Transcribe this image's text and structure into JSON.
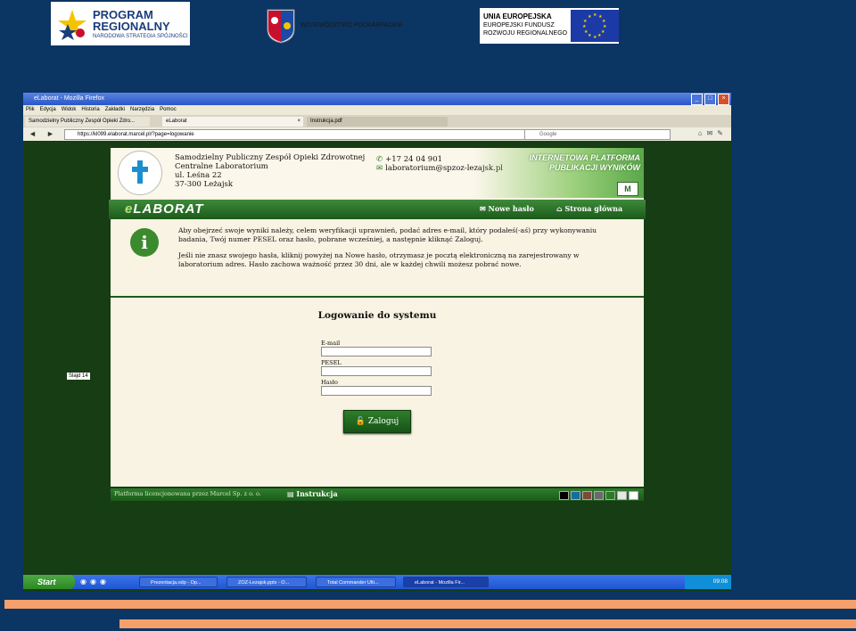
{
  "top_logos": {
    "program_line1": "PROGRAM",
    "program_line2": "REGIONALNY",
    "program_line3": "NARODOWA STRATEGIA SPÓJNOŚCI",
    "woj_text": "WOJEWÓDZTWO PODKARPACKIE",
    "ue_line1": "UNIA EUROPEJSKA",
    "ue_line2": "EUROPEJSKI FUNDUSZ",
    "ue_line3": "ROZWOJU REGIONALNEGO"
  },
  "browser": {
    "title": "eLaborat - Mozilla Firefox",
    "menu": [
      "Plik",
      "Edycja",
      "Widok",
      "Historia",
      "Zakładki",
      "Narzędzia",
      "Pomoc"
    ],
    "tabs": [
      {
        "label": "Samodzielny Publiczny Zespół Opieki Zdro..."
      },
      {
        "label": "eLaborat"
      },
      {
        "label": "Instrukcja.pdf"
      }
    ],
    "url": "https://kl099.elaborat.marcel.pl/?page=logowanie",
    "search_placeholder": "Google"
  },
  "site": {
    "org_name_1": "Samodzielny Publiczny Zespół Opieki Zdrowotnej",
    "org_name_2": "Centralne Laboratorium",
    "org_street": "ul. Leśna 22",
    "org_city": "37-300 Leżajsk",
    "phone": "+17 24 04 901",
    "email": "laboratorium@spzoz-lezajsk.pl",
    "banner_1": "INTERNETOWA PLATFORMA",
    "banner_2": "PUBLIKACJI WYNIKÓW",
    "banner_logo": "M",
    "brand_e": "e",
    "brand_rest": "LABORAT",
    "nav_new_password": "Nowe hasło",
    "nav_home": "Strona główna",
    "info_p1": "Aby obejrzeć swoje wyniki należy, celem weryfikacji uprawnień, podać adres e-mail, który podałeś(-aś) przy wykonywaniu badania, Twój numer PESEL oraz hasło, pobrane wcześniej, a następnie kliknąć Zaloguj.",
    "info_p2": "Jeśli nie znasz swojego hasła, kliknij powyżej na Nowe hasło, otrzymasz je pocztą elektroniczną na zarejestrowany w laboratorium adres. Hasło zachowa ważność przez 30 dni, ale w każdej chwili możesz pobrać nowe.",
    "login_title": "Logowanie do systemu",
    "label_email": "E-mail",
    "label_pesel": "PESEL",
    "label_password": "Hasło",
    "login_button": "Zaloguj",
    "footer_license": "Platforma licencjonowana przez Marcel Sp. z o. o.",
    "footer_manual": "Instrukcja",
    "swatch_colors": [
      "#000000",
      "#1a6aa0",
      "#7a4a3a",
      "#6a6a6a",
      "#2a7a2a",
      "#e6e6e6",
      "#ffffff"
    ]
  },
  "slide_label": "Slajd 14",
  "taskbar": {
    "start": "Start",
    "items": [
      {
        "label": "Prezentacja.odp - Op..."
      },
      {
        "label": "ZOZ-Lezajsk.pptx - O..."
      },
      {
        "label": "Total Commander Ulti..."
      },
      {
        "label": "eLaborat - Mozilla Fir..."
      }
    ],
    "clock": "09:08"
  }
}
